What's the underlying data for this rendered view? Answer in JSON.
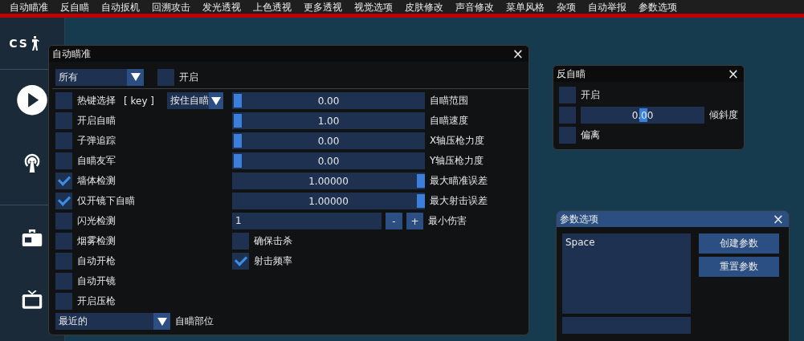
{
  "menu": [
    "自动瞄准",
    "反自瞄",
    "自动扳机",
    "回溯攻击",
    "发光透视",
    "上色透视",
    "更多透视",
    "视觉选项",
    "皮肤修改",
    "声音修改",
    "菜单风格",
    "杂项",
    "自动举报",
    "参数选项"
  ],
  "background": {
    "logo": "CS"
  },
  "aimbot": {
    "title": "自动瞄准",
    "close": "×",
    "target": {
      "value": "所有"
    },
    "enable": {
      "label": "开启",
      "checked": false
    },
    "options": [
      {
        "kind": "hotkey",
        "label": "热键选择",
        "key": "[ key ]",
        "mode": "按住自瞄",
        "checked": false
      },
      {
        "kind": "checkbox",
        "label": "开启自瞄",
        "checked": false
      },
      {
        "kind": "checkbox",
        "label": "子弹追踪",
        "checked": false
      },
      {
        "kind": "checkbox",
        "label": "自瞄友军",
        "checked": false
      },
      {
        "kind": "checkbox",
        "label": "墙体检测",
        "checked": true
      },
      {
        "kind": "checkbox",
        "label": "仅开镜下自瞄",
        "checked": true
      },
      {
        "kind": "checkbox",
        "label": "闪光检测",
        "checked": false
      },
      {
        "kind": "checkbox",
        "label": "烟雾检测",
        "checked": false
      },
      {
        "kind": "checkbox",
        "label": "自动开枪",
        "checked": false
      },
      {
        "kind": "checkbox",
        "label": "自动开镜",
        "checked": false
      },
      {
        "kind": "checkbox",
        "label": "开启压枪",
        "checked": false
      }
    ],
    "sliders": [
      {
        "value": "0.00",
        "label": "自瞄范围",
        "level": 0
      },
      {
        "value": "1.00",
        "label": "自瞄速度",
        "level": 0
      },
      {
        "value": "0.00",
        "label": "X轴压枪力度",
        "level": 0
      },
      {
        "value": "0.00",
        "label": "Y轴压枪力度",
        "level": 0
      },
      {
        "value": "1.00000",
        "label": "最大瞄准误差",
        "level": 1
      },
      {
        "value": "1.00000",
        "label": "最大射击误差",
        "level": 1
      }
    ],
    "min_damage": {
      "value": "1",
      "minus": "-",
      "plus": "+",
      "label": "最小伤害"
    },
    "extra": [
      {
        "label": "确保击杀",
        "checked": false
      },
      {
        "label": "射击频率",
        "checked": true
      }
    ],
    "bone": {
      "value": "最近的",
      "label": "自瞄部位"
    }
  },
  "anti_aim": {
    "title": "反自瞄",
    "close": "×",
    "enable": {
      "label": "开启",
      "checked": false
    },
    "pitch": {
      "checked": false,
      "value": "0.00",
      "label": "倾斜度",
      "level": 0.5
    },
    "offset": {
      "label": "偏离",
      "checked": false
    }
  },
  "config": {
    "title": "参数选项",
    "close": "×",
    "items": [
      "Space"
    ],
    "buttons": [
      "创建参数",
      "重置参数"
    ]
  }
}
